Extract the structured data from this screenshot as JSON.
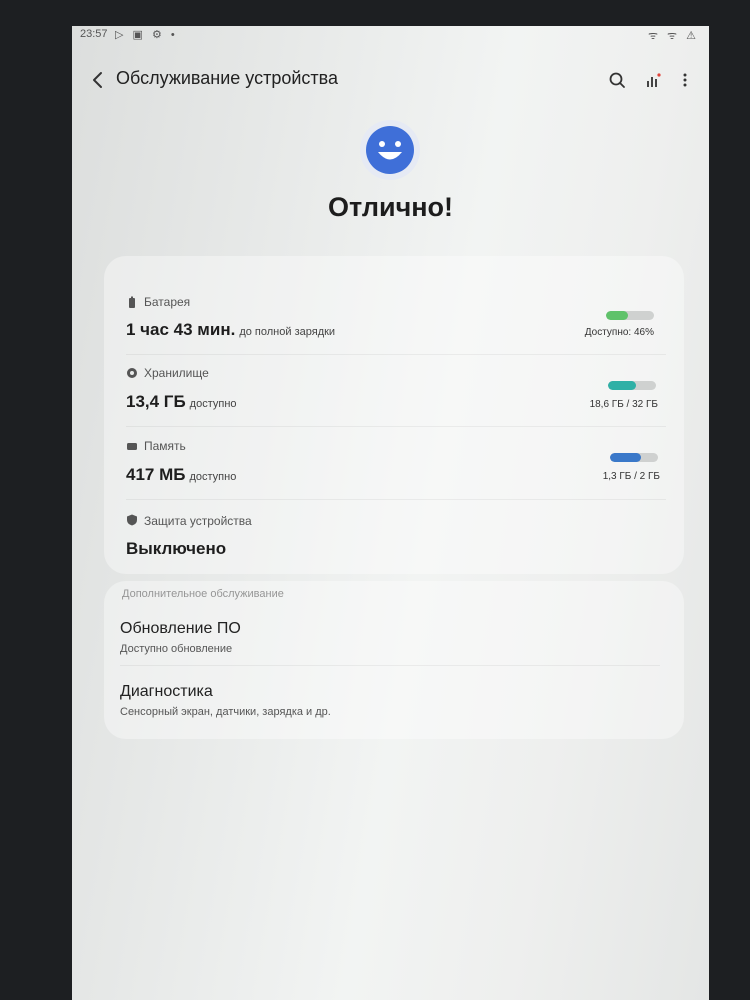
{
  "status_bar": {
    "time": "23:57",
    "left_icons": "▷ ▣ ⚙ •",
    "right_icons": "ᯤ ᯤ ⚠"
  },
  "header": {
    "title": "Обслуживание устройства",
    "back_icon": "chevron-left-icon",
    "search_icon": "search-icon",
    "stats_icon": "bar-chart-icon",
    "more_icon": "more-vertical-icon"
  },
  "overall": {
    "status": "Отлично!",
    "emoji_icon": "smiley-face-icon",
    "accent_color": "#3f6fd8"
  },
  "battery": {
    "label": "Батарея",
    "icon": "battery-icon",
    "value": "1 час 43 мин.",
    "suffix": "до полной зарядки",
    "caption": "Доступно: 46%",
    "level": 0.46,
    "color": "#5fc26a"
  },
  "storage": {
    "label": "Хранилище",
    "icon": "storage-icon",
    "value": "13,4 ГБ",
    "suffix": "доступно",
    "caption": "18,6 ГБ / 32 ГБ",
    "level": 0.58,
    "color": "#2fb0a6"
  },
  "memory": {
    "label": "Память",
    "icon": "memory-icon",
    "value": "417 МБ",
    "suffix": "доступно",
    "caption": "1,3 ГБ / 2 ГБ",
    "level": 0.65,
    "color": "#3a78c9"
  },
  "security": {
    "label": "Защита устройства",
    "icon": "shield-icon",
    "value": "Выключено"
  },
  "extra": {
    "section_header": "Дополнительное обслуживание",
    "items": [
      {
        "title": "Обновление ПО",
        "subtitle": "Доступно обновление"
      },
      {
        "title": "Диагностика",
        "subtitle": "Сенсорный экран, датчики, зарядка и др."
      }
    ]
  }
}
